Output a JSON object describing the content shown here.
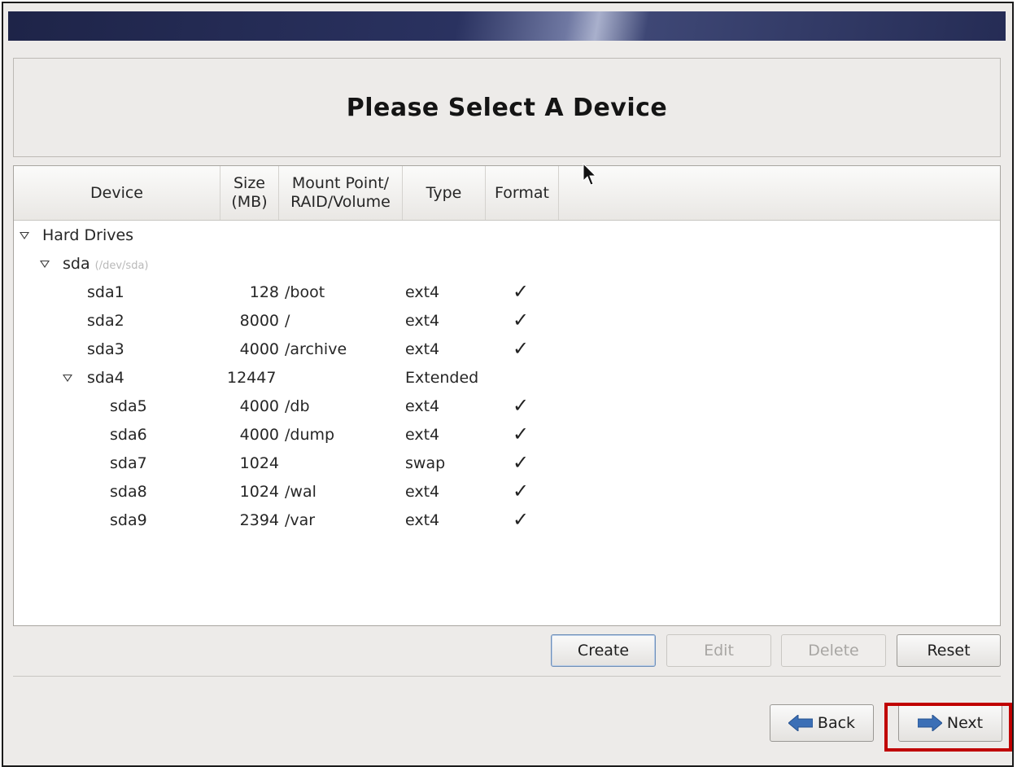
{
  "window": {
    "title": "Please Select A Device"
  },
  "columns": {
    "device": "Device",
    "size_line1": "Size",
    "size_line2": "(MB)",
    "mount_line1": "Mount Point/",
    "mount_line2": "RAID/Volume",
    "type": "Type",
    "format": "Format"
  },
  "tree": {
    "group_label": "Hard Drives",
    "disk": {
      "name": "sda",
      "path": "(/dev/sda)"
    },
    "partitions": [
      {
        "device": "sda1",
        "size": "128",
        "mount": "/boot",
        "type": "ext4",
        "format": "✓"
      },
      {
        "device": "sda2",
        "size": "8000",
        "mount": "/",
        "type": "ext4",
        "format": "✓"
      },
      {
        "device": "sda3",
        "size": "4000",
        "mount": "/archive",
        "type": "ext4",
        "format": "✓"
      },
      {
        "device": "sda4",
        "size": "12447",
        "mount": "",
        "type": "Extended",
        "format": ""
      },
      {
        "device": "sda5",
        "size": "4000",
        "mount": "/db",
        "type": "ext4",
        "format": "✓"
      },
      {
        "device": "sda6",
        "size": "4000",
        "mount": "/dump",
        "type": "ext4",
        "format": "✓"
      },
      {
        "device": "sda7",
        "size": "1024",
        "mount": "",
        "type": "swap",
        "format": "✓"
      },
      {
        "device": "sda8",
        "size": "1024",
        "mount": "/wal",
        "type": "ext4",
        "format": "✓"
      },
      {
        "device": "sda9",
        "size": "2394",
        "mount": "/var",
        "type": "ext4",
        "format": "✓"
      }
    ]
  },
  "actions": {
    "create": "Create",
    "edit": "Edit",
    "delete": "Delete",
    "reset": "Reset"
  },
  "nav": {
    "back": "Back",
    "next": "Next"
  },
  "colors": {
    "highlight": "#c00000",
    "banner": "#252c55",
    "nav_arrow": "#3b6fb6"
  }
}
